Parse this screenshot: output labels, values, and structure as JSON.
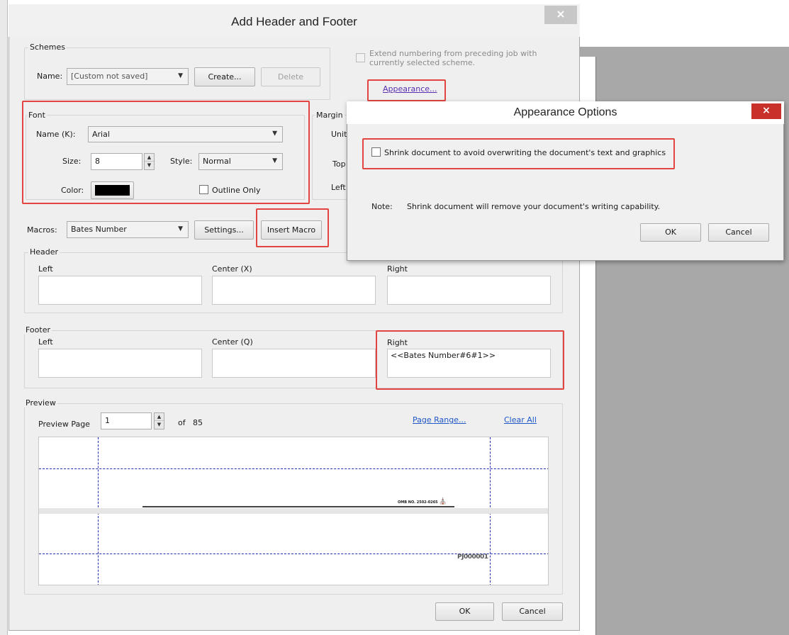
{
  "main_dialog": {
    "title": "Add Header and Footer",
    "close_label": "×"
  },
  "schemes": {
    "group_label": "Schemes",
    "name_label": "Name:",
    "name_value": "[Custom not saved]",
    "create_label": "Create...",
    "delete_label": "Delete",
    "extend_numbering_line1": "Extend numbering from preceding job with",
    "extend_numbering_line2": "currently selected scheme.",
    "appearance_link": "Appearance..."
  },
  "font": {
    "group_label": "Font",
    "name_label": "Name (K):",
    "name_value": "Arial",
    "size_label": "Size:",
    "size_value": "8",
    "style_label": "Style:",
    "style_value": "Normal",
    "color_label": "Color:",
    "color_value": "#000000",
    "outline_only_label": "Outline Only"
  },
  "margin": {
    "group_label": "Margin",
    "units_label": "Unit:",
    "top_label": "Top:",
    "left_label": "Left:"
  },
  "macros": {
    "label": "Macros:",
    "value": "Bates Number",
    "settings_label": "Settings...",
    "insert_label": "Insert Macro"
  },
  "header": {
    "group_label": "Header",
    "left_label": "Left",
    "center_label": "Center (X)",
    "right_label": "Right"
  },
  "footer": {
    "group_label": "Footer",
    "left_label": "Left",
    "center_label": "Center (Q)",
    "right_label": "Right",
    "right_value": "<<Bates Number#6#1>>"
  },
  "preview": {
    "group_label": "Preview",
    "page_label": "Preview Page",
    "page_value": "1",
    "of_label": "of",
    "total_pages": "85",
    "page_range_link": "Page Range...",
    "clear_all_link": "Clear All",
    "header_text": "OMB NO. 2502-0265",
    "footer_text": "PJ000001"
  },
  "buttons": {
    "ok_label": "OK",
    "cancel_label": "Cancel"
  },
  "appearance_dialog": {
    "title": "Appearance Options",
    "close_label": "×",
    "shrink_label": "Shrink document to avoid overwriting the document's text and graphics",
    "note_label": "Note:",
    "note_text": "Shrink document will remove your document's writing capability.",
    "ok_label": "OK",
    "cancel_label": "Cancel"
  },
  "colors": {
    "highlight_red": "#e2453f",
    "close_red": "#c8302a",
    "link_blue": "#1d56c7",
    "guide_blue": "#2030b0"
  }
}
